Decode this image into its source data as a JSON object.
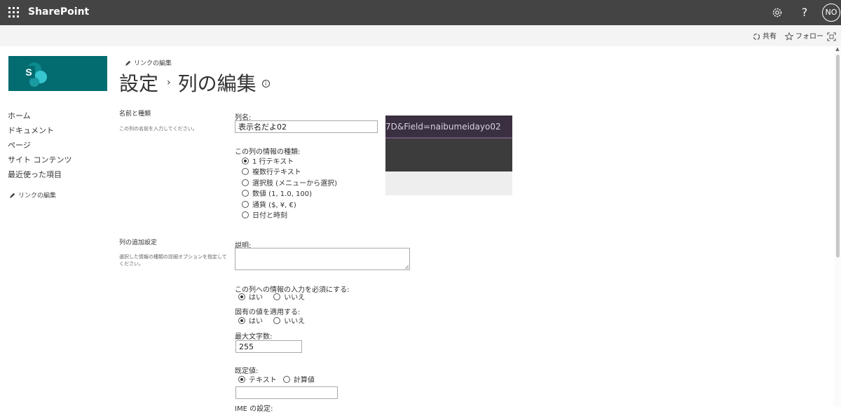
{
  "suite_bar": {
    "app_name": "SharePoint",
    "help_glyph": "?",
    "user_initials": "NO",
    "icons": [
      "waffle-icon",
      "gear-icon",
      "help-icon"
    ]
  },
  "command_bar": {
    "share_label": "共有",
    "follow_label": "フォロー",
    "icons": [
      "share-icon",
      "star-icon",
      "focus-mode-icon"
    ]
  },
  "header": {
    "edit_links_label": "リンクの編集",
    "breadcrumb_root": "設定",
    "breadcrumb_separator": "›",
    "page_title": "列の編集",
    "info_glyph": "i"
  },
  "left_nav": {
    "items": [
      {
        "label": "ホーム"
      },
      {
        "label": "ドキュメント"
      },
      {
        "label": "ページ"
      },
      {
        "label": "サイト コンテンツ"
      },
      {
        "label": "最近使った項目"
      }
    ],
    "edit_links_label": "リンクの編集"
  },
  "section_name_type": {
    "title": "名前と種類",
    "description": "この列の名前を入力してください。"
  },
  "section_additional": {
    "title": "列の追加設定",
    "description": "選択した情報の種類の詳細オプションを指定してください。"
  },
  "form": {
    "column_name_label": "列名:",
    "column_name_value": "表示名だよ02",
    "type_label": "この列の情報の種類:",
    "type_options": [
      {
        "label": "1 行テキスト",
        "selected": true
      },
      {
        "label": "複数行テキスト",
        "selected": false
      },
      {
        "label": "選択肢 (メニューから選択)",
        "selected": false
      },
      {
        "label": "数値 (1, 1.0, 100)",
        "selected": false
      },
      {
        "label": "通貨 ($, ¥, €)",
        "selected": false
      },
      {
        "label": "日付と時刻",
        "selected": false
      }
    ],
    "description_label": "説明:",
    "description_value": "",
    "required_label": "この列への情報の入力を必須にする:",
    "required_yes": "はい",
    "required_no": "いいえ",
    "required_selected": "はい",
    "unique_label": "固有の値を適用する:",
    "unique_yes": "はい",
    "unique_no": "いいえ",
    "unique_selected": "はい",
    "max_length_label": "最大文字数:",
    "max_length_value": "255",
    "default_label": "既定値:",
    "default_text_option": "テキスト",
    "default_calc_option": "計算値",
    "default_selected": "テキスト",
    "default_value": "",
    "ime_label_partial": "IME の設定:"
  },
  "overlay": {
    "url_fragment": "7D&Field=naibumeidayo02"
  },
  "colors": {
    "suite_bar": "#444444",
    "site_logo": "#036c70",
    "overlay_url_bg": "#3a3041"
  }
}
